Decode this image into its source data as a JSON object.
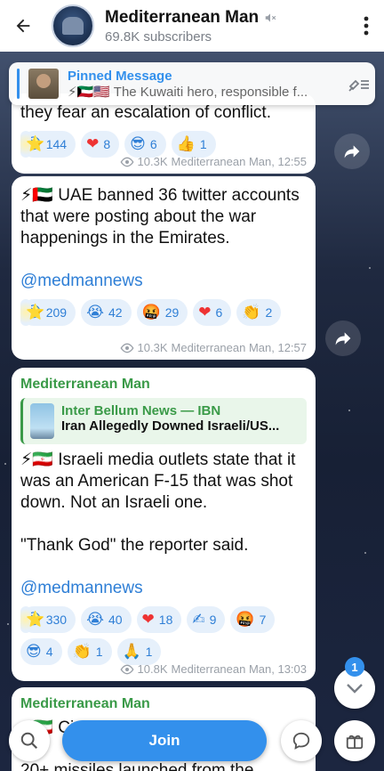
{
  "header": {
    "title": "Mediterranean Man",
    "subtitle": "69.8K subscribers"
  },
  "pinned": {
    "title": "Pinned Message",
    "preview": "⚡🇰🇼🇺🇸 The Kuwaiti hero, responsible f..."
  },
  "messages": [
    {
      "partial_text": "they fear an escalation of conflict.",
      "reactions": [
        {
          "emoji": "⭐",
          "count": ""
        },
        {
          "emoji": "😁",
          "count": "144"
        },
        {
          "emoji": "❤",
          "count": "8"
        },
        {
          "emoji": "😎",
          "count": "6"
        },
        {
          "emoji": "👍",
          "count": "1"
        }
      ],
      "views": "10.3K",
      "author_time": "Mediterranean Man, 12:55"
    },
    {
      "text": "⚡🇦🇪 UAE banned 36 twitter accounts that were posting about the war happenings in the Emirates.",
      "link": "@medmannews",
      "reactions": [
        {
          "emoji": "⭐",
          "count": ""
        },
        {
          "emoji": "😁",
          "count": "209"
        },
        {
          "emoji": "😭",
          "count": "42"
        },
        {
          "emoji": "🤬",
          "count": "29"
        },
        {
          "emoji": "❤",
          "count": "6"
        },
        {
          "emoji": "👏",
          "count": "2"
        }
      ],
      "views": "10.3K",
      "author_time": "Mediterranean Man, 12:57"
    },
    {
      "sender": "Mediterranean Man",
      "reply_title": "Inter Bellum News — IBN",
      "reply_body": "Iran Allegedly Downed Israeli/US...",
      "text1": "⚡🇮🇷 Israeli media outlets state that it was an American F-15 that was shot down. Not an Israeli one.",
      "text2": "\"Thank God\" the reporter said.",
      "link": "@medmannews",
      "reactions": [
        {
          "emoji": "⭐",
          "count": ""
        },
        {
          "emoji": "😁",
          "count": "330"
        },
        {
          "emoji": "😭",
          "count": "40"
        },
        {
          "emoji": "❤",
          "count": "18"
        },
        {
          "emoji": "✍",
          "count": "9"
        },
        {
          "emoji": "🤬",
          "count": "7"
        },
        {
          "emoji": "😎",
          "count": "4"
        },
        {
          "emoji": "👏",
          "count": "1"
        },
        {
          "emoji": "🙏",
          "count": "1"
        }
      ],
      "views": "10.8K",
      "author_time": "Mediterranean Man, 13:03"
    },
    {
      "sender": "Mediterranean Man",
      "partial_text_1": "⚡🇮🇷 Ci... Kuwaiti ... repo",
      "partial_text_3": "20+ missiles launched from the"
    }
  ],
  "bottom": {
    "join_label": "Join",
    "unread_badge": "1"
  },
  "colors": {
    "accent": "#3390ec",
    "sender_green": "#3a9a48",
    "reaction_bg": "#e6f0fb"
  }
}
